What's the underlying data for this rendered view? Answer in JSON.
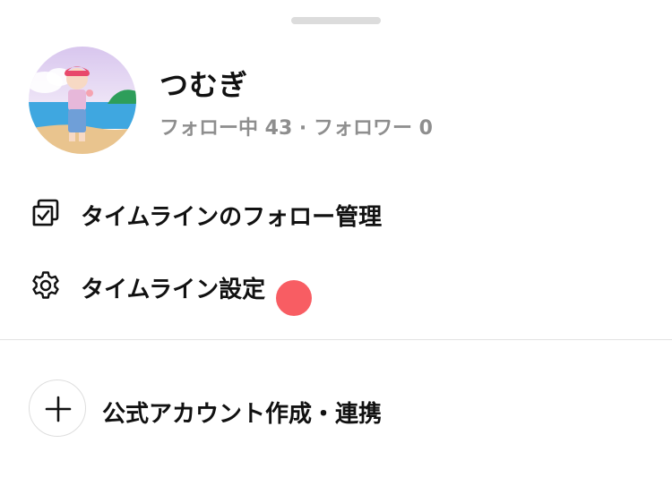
{
  "profile": {
    "name": "つむぎ",
    "stats": "フォロー中 43 · フォロワー 0"
  },
  "menu": {
    "items": [
      {
        "label": "タイムラインのフォロー管理",
        "icon": "checked-box-icon"
      },
      {
        "label": "タイムライン設定",
        "icon": "gear-icon"
      }
    ]
  },
  "official_account": {
    "label": "公式アカウント作成・連携",
    "icon": "plus-icon"
  },
  "colors": {
    "text_primary": "#111111",
    "text_secondary": "#8e8e8e",
    "divider": "#e2e2e2",
    "touch_indicator": "#f8545b"
  }
}
